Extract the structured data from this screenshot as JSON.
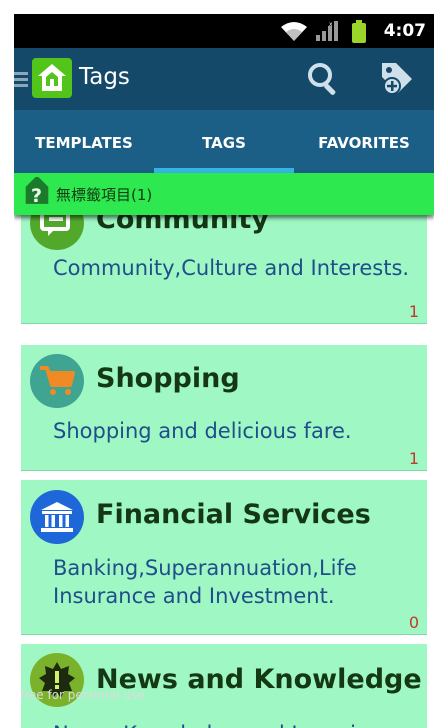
{
  "status_bar": {
    "time": "4:07",
    "icons": [
      "wifi-icon",
      "signal-icon",
      "battery-icon"
    ],
    "battery_color": "#9bd52a"
  },
  "action_bar": {
    "title": "Tags",
    "app_icon": "home-tag-icon",
    "search_icon": "search-icon",
    "add_tag_icon": "add-tag-icon",
    "color": "#14496a"
  },
  "tabs": [
    {
      "label": "TEMPLATES",
      "active": false
    },
    {
      "label": "TAGS",
      "active": true
    },
    {
      "label": "FAVORITES",
      "active": false
    }
  ],
  "untagged": {
    "label": "無標籤項目(1)",
    "icon": "question-tag-icon",
    "color": "#2ee84f"
  },
  "categories": [
    {
      "title": "Community",
      "description": "Community,Culture and Interests.",
      "count": "1",
      "icon": "chat-bubble-icon",
      "icon_color": "#52a82a"
    },
    {
      "title": "Shopping",
      "description": "Shopping and delicious fare.",
      "count": "1",
      "icon": "shopping-cart-icon",
      "icon_color": "#3fa491"
    },
    {
      "title": "Financial Services",
      "description": "Banking,Superannuation,Life Insurance and Investment.",
      "count": "0",
      "icon": "bank-icon",
      "icon_color": "#1e67d8"
    },
    {
      "title": "News and Knowledge",
      "description": "News, Knowledge and Learning",
      "count": "",
      "icon": "alert-burst-icon",
      "icon_color": "#7ab32b"
    }
  ],
  "card_color": "#9ff7c4",
  "watermark": "free for personal use"
}
